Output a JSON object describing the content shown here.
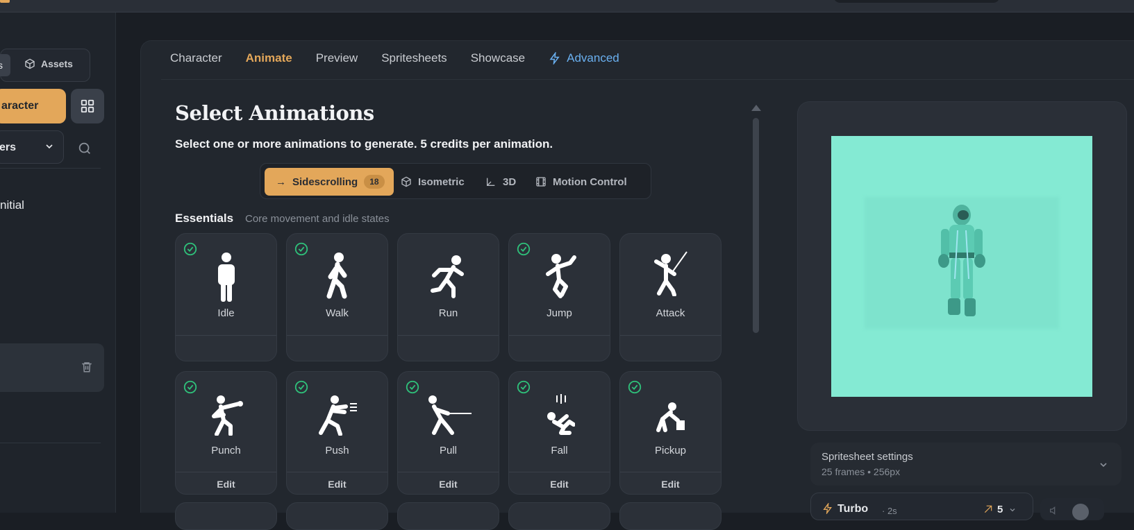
{
  "colors": {
    "accent": "#e3a75a",
    "advanced": "#6ab0f0",
    "check": "#2fc07a",
    "preview_bg": "#84ead3"
  },
  "sidebar": {
    "seg_active_fragment": "s",
    "assets_label": "Assets",
    "create_label": "aracter",
    "filter_label": "ers",
    "item_label": "nitial"
  },
  "tabs": {
    "character": "Character",
    "animate": "Animate",
    "preview": "Preview",
    "spritesheets": "Spritesheets",
    "showcase": "Showcase",
    "advanced": "Advanced"
  },
  "page": {
    "title": "Select Animations",
    "subtitle": "Select one or more animations to generate. 5 credits per animation."
  },
  "modes": {
    "sidescrolling": "Sidescrolling",
    "sidescrolling_count": "18",
    "isometric": "Isometric",
    "threed": "3D",
    "motion": "Motion Control"
  },
  "section": {
    "title": "Essentials",
    "desc": "Core movement and idle states"
  },
  "cards": [
    {
      "label": "Idle",
      "checked": true,
      "icon": "idle-icon"
    },
    {
      "label": "Walk",
      "checked": true,
      "icon": "walk-icon"
    },
    {
      "label": "Run",
      "checked": false,
      "icon": "run-icon"
    },
    {
      "label": "Jump",
      "checked": true,
      "icon": "jump-icon"
    },
    {
      "label": "Attack",
      "checked": false,
      "icon": "attack-icon"
    },
    {
      "label": "Punch",
      "checked": true,
      "icon": "punch-icon",
      "edit": "Edit"
    },
    {
      "label": "Push",
      "checked": true,
      "icon": "push-icon",
      "edit": "Edit"
    },
    {
      "label": "Pull",
      "checked": true,
      "icon": "pull-icon",
      "edit": "Edit"
    },
    {
      "label": "Fall",
      "checked": true,
      "icon": "fall-icon",
      "edit": "Edit"
    },
    {
      "label": "Pickup",
      "checked": true,
      "icon": "pickup-icon",
      "edit": "Edit"
    }
  ],
  "settings": {
    "title": "Spritesheet settings",
    "detail": "25 frames • 256px"
  },
  "turbo": {
    "label": "Turbo",
    "time": "· 2s",
    "credits": "5"
  }
}
